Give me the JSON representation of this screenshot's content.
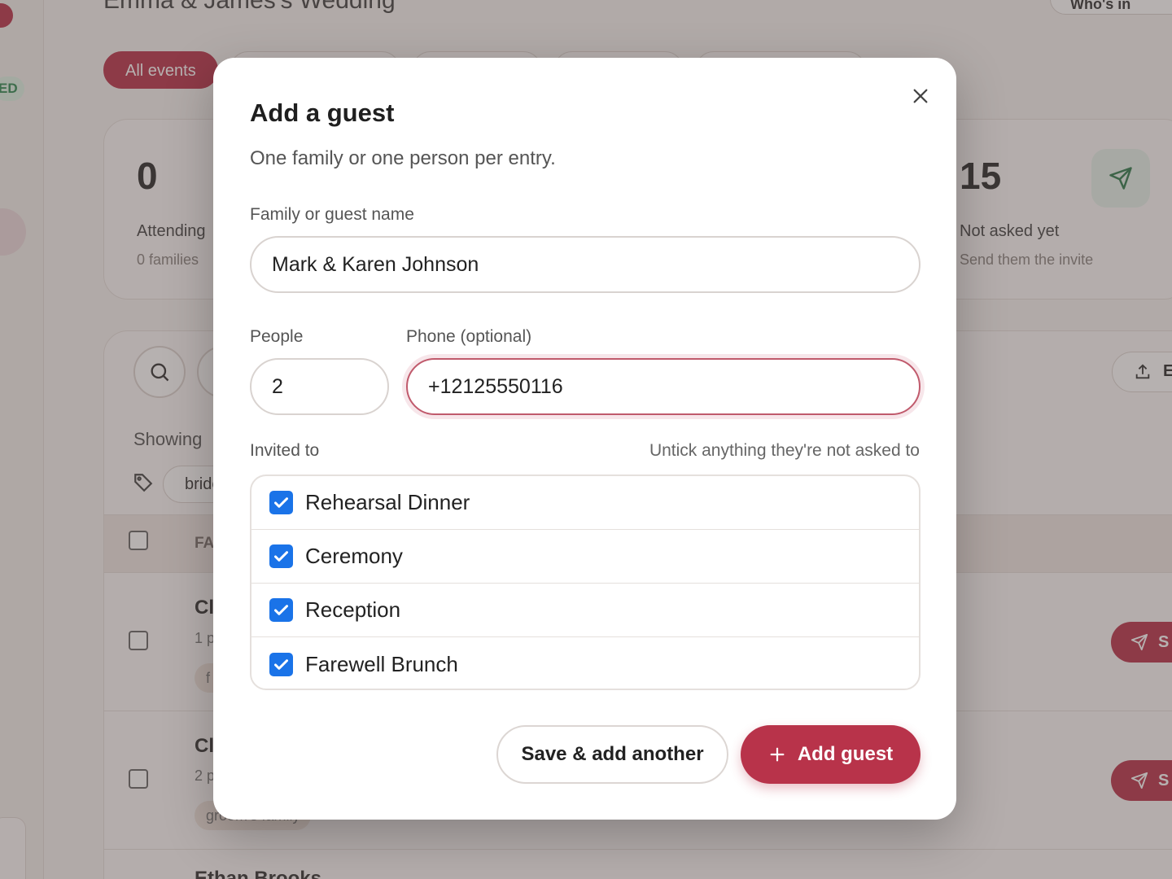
{
  "background": {
    "page_title": "Emma & James's Wedding",
    "who_button_label": "Who's in",
    "filter_chips": [
      "All events",
      "",
      "",
      "",
      ""
    ],
    "stats": {
      "attending": {
        "number": "0",
        "label": "Attending",
        "sub": "0 families"
      },
      "not_asked": {
        "number": "15",
        "label": "Not asked yet",
        "sub": "Send them the invite"
      }
    },
    "showing_label": "Showing",
    "tag_filter": "bride",
    "table_header": "FA",
    "rows": [
      {
        "title": "Cl",
        "sub": "1 p",
        "tag": "f",
        "send": "S"
      },
      {
        "title": "Cl",
        "sub": "2 p",
        "tag": "groom's family",
        "send": "S"
      },
      {
        "title": "Ethan Brooks"
      }
    ],
    "export_label": "E"
  },
  "modal": {
    "title": "Add a guest",
    "subtitle": "One family or one person per entry.",
    "name_label": "Family or guest name",
    "name_value": "Mark & Karen Johnson",
    "people_label": "People",
    "people_value": "2",
    "phone_label": "Phone (optional)",
    "phone_value": "+12125550116",
    "invited_label": "Invited to",
    "invited_hint": "Untick anything they're not asked to",
    "events": [
      {
        "name": "Rehearsal Dinner",
        "checked": true
      },
      {
        "name": "Ceremony",
        "checked": true
      },
      {
        "name": "Reception",
        "checked": true
      },
      {
        "name": "Farewell Brunch",
        "checked": true
      }
    ],
    "save_another_label": "Save & add another",
    "add_guest_label": "Add guest"
  },
  "colors": {
    "brand": "#b8334a",
    "checkbox": "#1a73e8",
    "overlay": "rgba(80,70,66,0.42)"
  },
  "icons": [
    "close-icon",
    "plus-icon",
    "send-icon",
    "search-icon",
    "tag-icon",
    "upload-icon",
    "check-icon"
  ]
}
